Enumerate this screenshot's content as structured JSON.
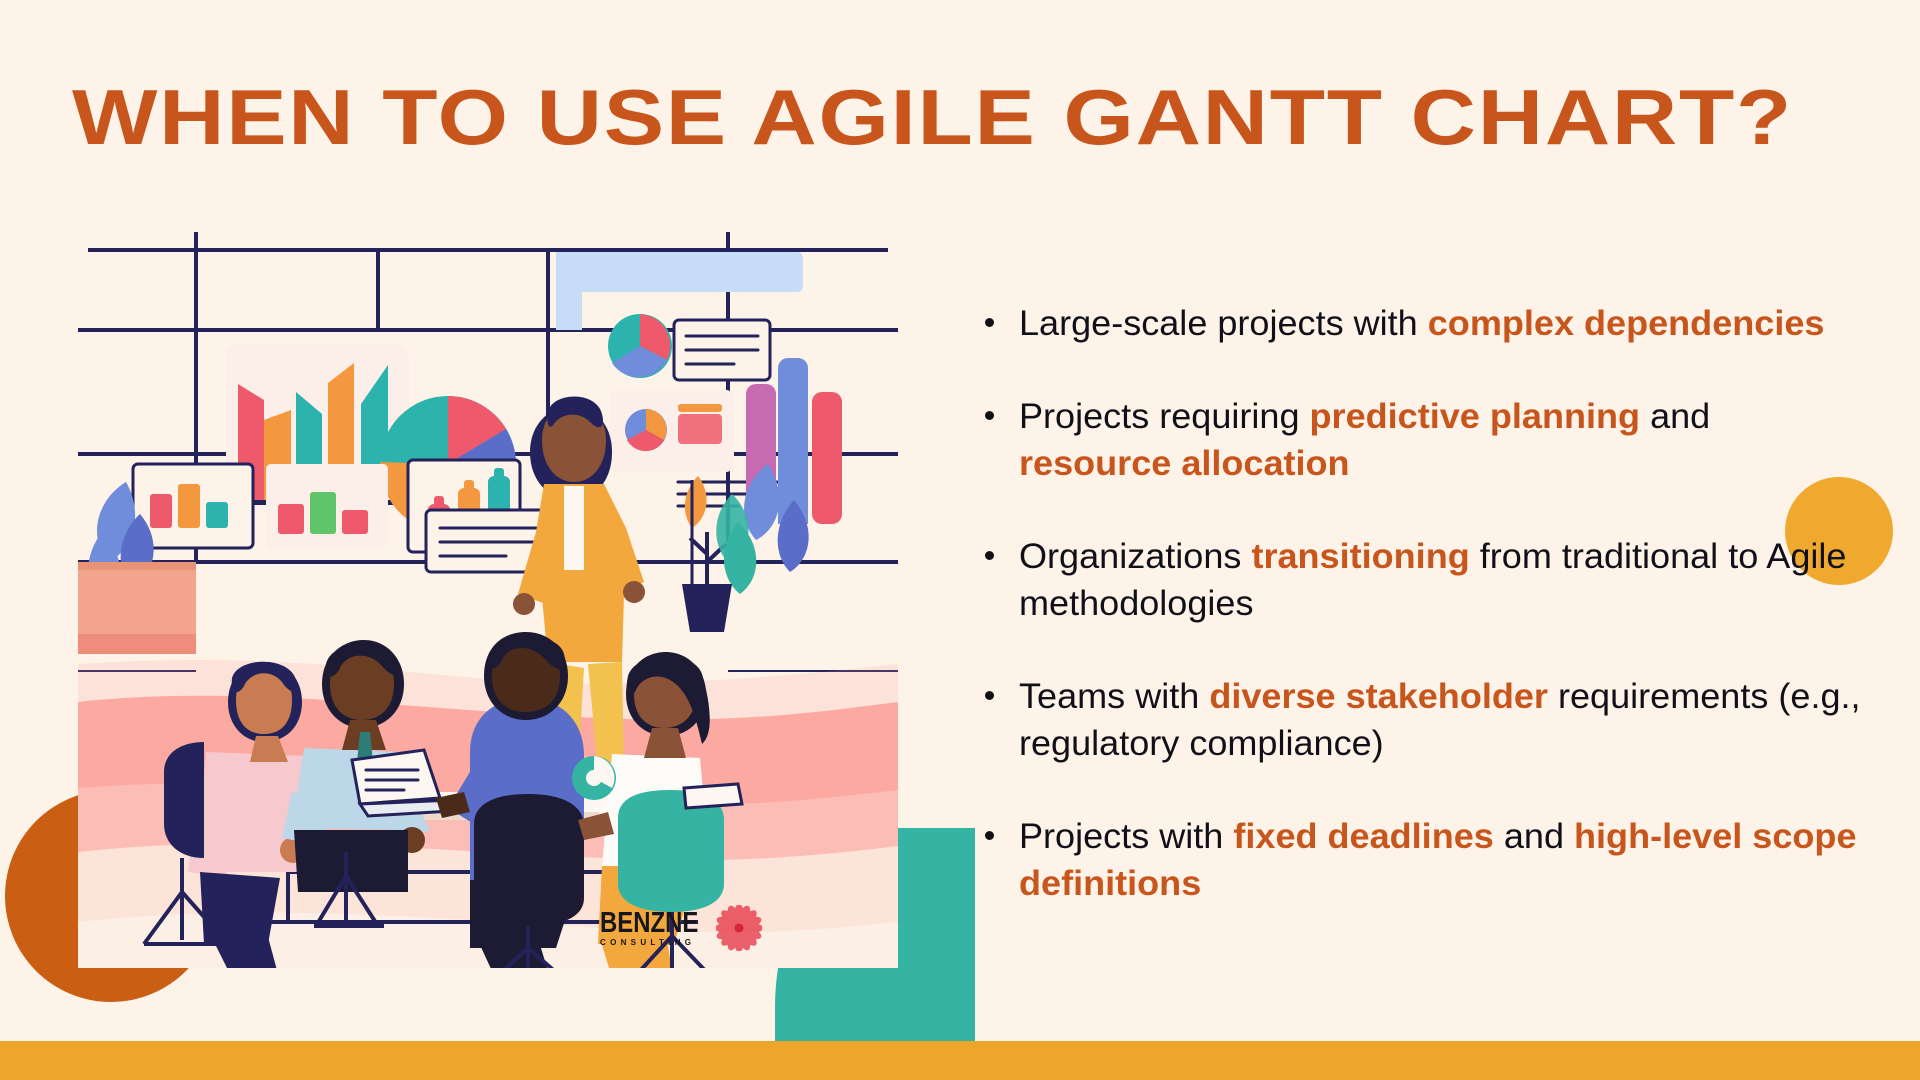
{
  "slide": {
    "background_color": "#FDF3E8",
    "accent_orange": "#C8551B",
    "accent_yellow": "#EDA62B",
    "accent_teal": "#35B4A3",
    "accent_dark_orange": "#CA5F13",
    "title": "WHEN TO USE AGILE GANTT CHART?"
  },
  "bullets": [
    {
      "parts": [
        {
          "text": "Large-scale projects with ",
          "highlight": false
        },
        {
          "text": "complex dependencies",
          "highlight": true
        }
      ]
    },
    {
      "parts": [
        {
          "text": "Projects requiring ",
          "highlight": false
        },
        {
          "text": "predictive planning",
          "highlight": true
        },
        {
          "text": " and ",
          "highlight": false
        },
        {
          "text": "resource allocation",
          "highlight": true
        }
      ]
    },
    {
      "parts": [
        {
          "text": "Organizations ",
          "highlight": false
        },
        {
          "text": "transitioning",
          "highlight": true
        },
        {
          "text": " from traditional to Agile methodologies",
          "highlight": false
        }
      ]
    },
    {
      "parts": [
        {
          "text": "Teams with ",
          "highlight": false
        },
        {
          "text": "diverse stakeholder",
          "highlight": true
        },
        {
          "text": " requirements (e.g., regulatory compliance)",
          "highlight": false
        }
      ]
    },
    {
      "parts": [
        {
          "text": "Projects with ",
          "highlight": false
        },
        {
          "text": "fixed deadlines",
          "highlight": true
        },
        {
          "text": " and ",
          "highlight": false
        },
        {
          "text": "high-level scope definitions",
          "highlight": true
        }
      ]
    }
  ],
  "logo": {
    "word": "BENZNE",
    "subtitle": "CONSULTING",
    "flower_color": "#E8414F"
  },
  "illustration": {
    "description": "Flat illustration of a business team meeting in front of dashboards with charts",
    "charts": {
      "bar_chart": {
        "type": "bar",
        "values": [
          72,
          46,
          60,
          86,
          80
        ],
        "colors": [
          "#EE5A6B",
          "#F3983E",
          "#2DB3AE",
          "#F3983E",
          "#2DB3AE"
        ]
      },
      "pie_chart": {
        "type": "pie",
        "slices": [
          {
            "label": "teal",
            "value": 38,
            "color": "#2DB3AE"
          },
          {
            "label": "pink",
            "value": 12,
            "color": "#EE5A6B"
          },
          {
            "label": "blue",
            "value": 22,
            "color": "#5A6DC8"
          },
          {
            "label": "orange",
            "value": 28,
            "color": "#F3983E"
          }
        ]
      },
      "small_pie_chart": {
        "type": "pie",
        "slices": [
          {
            "label": "pink",
            "value": 45,
            "color": "#EE5A6B"
          },
          {
            "label": "teal",
            "value": 35,
            "color": "#2DB3AE"
          },
          {
            "label": "blue",
            "value": 20,
            "color": "#6F8DDB"
          }
        ]
      },
      "column_chart": {
        "type": "bar",
        "values": [
          52,
          72,
          88
        ],
        "colors": [
          "#EE5A6B",
          "#F3983E",
          "#2DB3AE"
        ]
      },
      "tall_bars": {
        "type": "bar",
        "values": [
          60,
          88,
          74
        ],
        "colors": [
          "#C76BB0",
          "#6F8DDB",
          "#EE5A6B"
        ]
      }
    }
  }
}
